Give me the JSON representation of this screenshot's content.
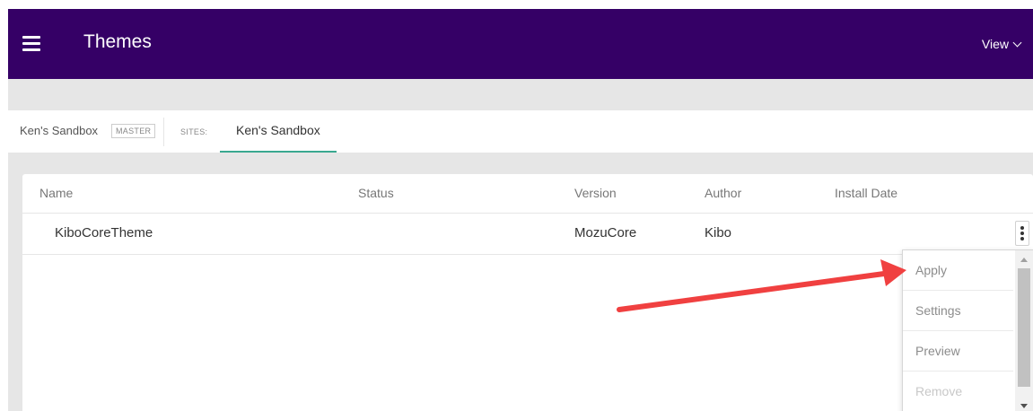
{
  "header": {
    "title": "Themes",
    "view_label": "View",
    "menu_icon": "hamburger-menu-icon",
    "view_icon": "chevron-down-icon",
    "color": "#350066"
  },
  "site_bar": {
    "tenant_name": "Ken's Sandbox",
    "master_badge": "MASTER",
    "sites_label": "SITES:",
    "active_site_tab": "Ken's Sandbox",
    "tab_underline_color": "#3aa890"
  },
  "table": {
    "columns": [
      "Name",
      "Status",
      "Version",
      "Author",
      "Install Date"
    ],
    "rows": [
      {
        "name": "KiboCoreTheme",
        "status": "",
        "version": "MozuCore",
        "author": "Kibo",
        "install_date": ""
      }
    ],
    "row_action_icon": "kebab-more-icon"
  },
  "row_actions_menu": {
    "items": [
      {
        "label": "Apply",
        "enabled": true
      },
      {
        "label": "Settings",
        "enabled": true
      },
      {
        "label": "Preview",
        "enabled": true
      },
      {
        "label": "Remove",
        "enabled": false
      }
    ]
  },
  "annotation": {
    "arrow_color": "#f04040",
    "arrow_icon": "annotation-arrow-icon"
  }
}
